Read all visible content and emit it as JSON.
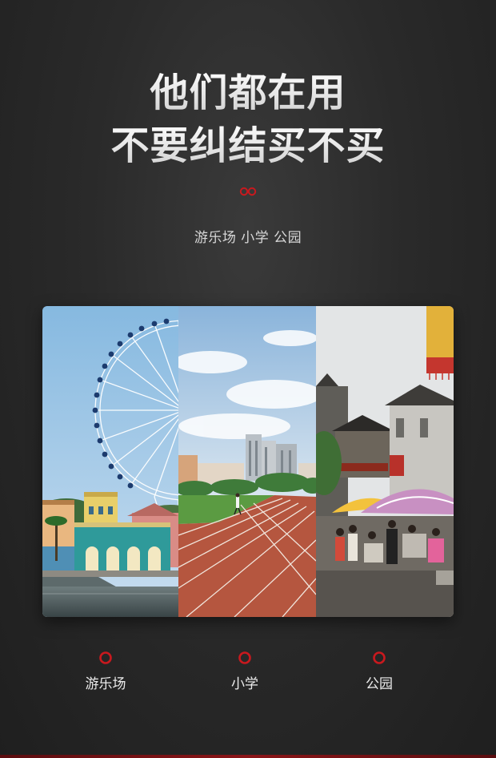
{
  "headline": {
    "line1": "他们都在用",
    "line2": "不要纠结买不买"
  },
  "subtitle": "游乐场 小学 公园",
  "colors": {
    "accent": "#c8191e",
    "background": "#2a2a2a",
    "text": "#ececec"
  },
  "photos": [
    {
      "name": "amusement-park-photo",
      "icon": "ferris-wheel"
    },
    {
      "name": "school-photo",
      "icon": "running-track"
    },
    {
      "name": "park-photo",
      "icon": "market-umbrellas"
    }
  ],
  "labels": [
    {
      "text": "游乐场",
      "icon": "red-ring-icon"
    },
    {
      "text": "小学",
      "icon": "red-ring-icon"
    },
    {
      "text": "公园",
      "icon": "red-ring-icon"
    }
  ]
}
